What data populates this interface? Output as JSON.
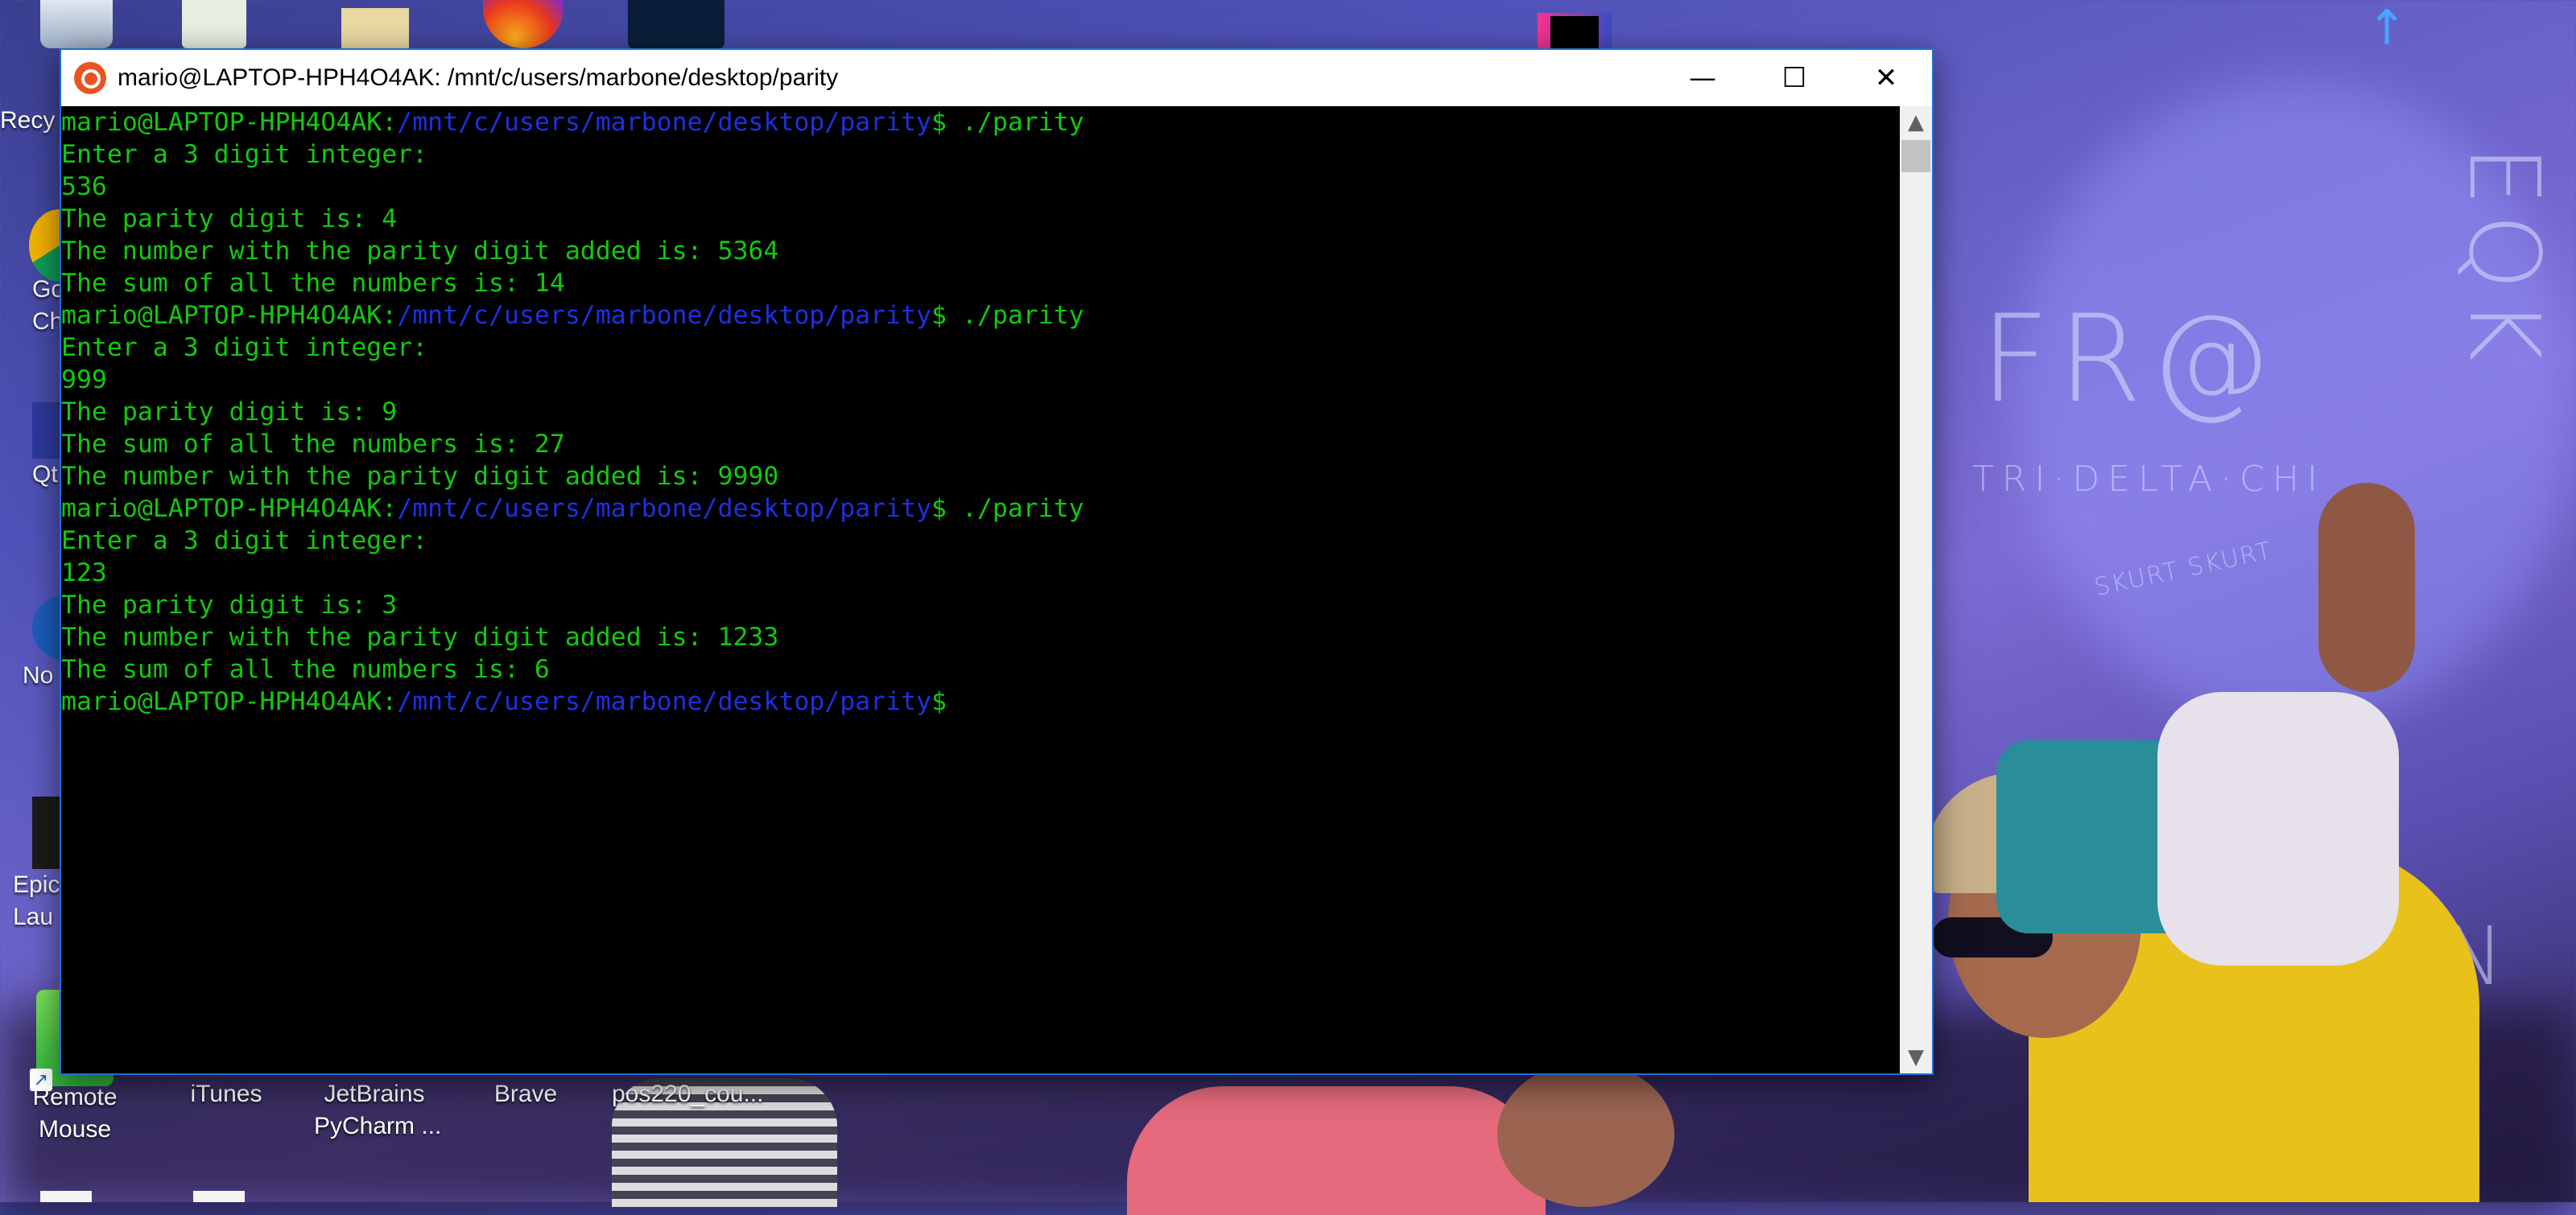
{
  "window": {
    "title": "mario@LAPTOP-HPH4O4AK: /mnt/c/users/marbone/desktop/parity",
    "minimize_glyph": "—",
    "maximize_glyph": "☐",
    "close_glyph": "✕"
  },
  "terminal": {
    "prompt_user": "mario@LAPTOP-HPH4O4AK",
    "prompt_colon": ":",
    "prompt_path": "/mnt/c/users/marbone/desktop/parity",
    "lines": [
      {
        "type": "prompt",
        "cmd": "$ ./parity"
      },
      {
        "type": "out",
        "text": "Enter a 3 digit integer:"
      },
      {
        "type": "out",
        "text": "536"
      },
      {
        "type": "out",
        "text": "The parity digit is: 4"
      },
      {
        "type": "out",
        "text": "The number with the parity digit added is: 5364"
      },
      {
        "type": "out",
        "text": "The sum of all the numbers is: 14"
      },
      {
        "type": "prompt",
        "cmd": "$ ./parity"
      },
      {
        "type": "out",
        "text": "Enter a 3 digit integer:"
      },
      {
        "type": "out",
        "text": "999"
      },
      {
        "type": "out",
        "text": "The parity digit is: 9"
      },
      {
        "type": "out",
        "text": "The sum of all the numbers is: 27"
      },
      {
        "type": "out",
        "text": "The number with the parity digit added is: 9990"
      },
      {
        "type": "prompt",
        "cmd": "$ ./parity"
      },
      {
        "type": "out",
        "text": "Enter a 3 digit integer:"
      },
      {
        "type": "out",
        "text": "123"
      },
      {
        "type": "out",
        "text": "The parity digit is: 3"
      },
      {
        "type": "out",
        "text": "The number with the parity digit added is: 1233"
      },
      {
        "type": "out",
        "text": "The sum of all the numbers is: 6"
      },
      {
        "type": "prompt",
        "cmd": "$"
      }
    ]
  },
  "desktop": {
    "left_icons": [
      {
        "label": "Recy"
      },
      {
        "label": "Go\nCh"
      },
      {
        "label": "Qt"
      },
      {
        "label": "No"
      },
      {
        "label": "Epic\nLau"
      },
      {
        "label": "Remote\nMouse"
      }
    ],
    "bottom_icons": [
      {
        "label": "iTunes"
      },
      {
        "label": "JetBrains\nPyCharm ..."
      },
      {
        "label": "Brave"
      },
      {
        "label": "pos220_cou..."
      }
    ]
  },
  "wallpaper_text": [
    "FR@",
    "TRI·DELTA·CHI",
    "SKURT SKURT",
    "BN"
  ],
  "colors": {
    "terminal_green": "#13c80f",
    "terminal_path_blue": "#1f2fe0",
    "terminal_bg": "#000000",
    "ubuntu_orange": "#e95420"
  }
}
